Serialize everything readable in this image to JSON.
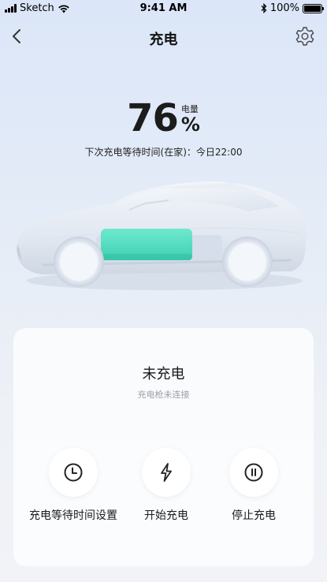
{
  "status_bar": {
    "carrier": "Sketch",
    "time": "9:41 AM",
    "battery": "100%"
  },
  "nav": {
    "title": "充电"
  },
  "battery_level": {
    "value": "76",
    "unit": "%",
    "label": "电量"
  },
  "schedule_text": "下次充电等待时间(在家)：今日22:00",
  "card": {
    "status": "未充电",
    "sub_status": "充电枪未连接"
  },
  "actions": [
    {
      "label": "充电等待时间设置",
      "icon": "clock-icon"
    },
    {
      "label": "开始充电",
      "icon": "lightning-icon"
    },
    {
      "label": "停止充电",
      "icon": "pause-icon"
    }
  ],
  "colors": {
    "battery_accent": "#4fd9bd",
    "background_top": "#dbe6f8",
    "card_bg": "#ffffff"
  }
}
